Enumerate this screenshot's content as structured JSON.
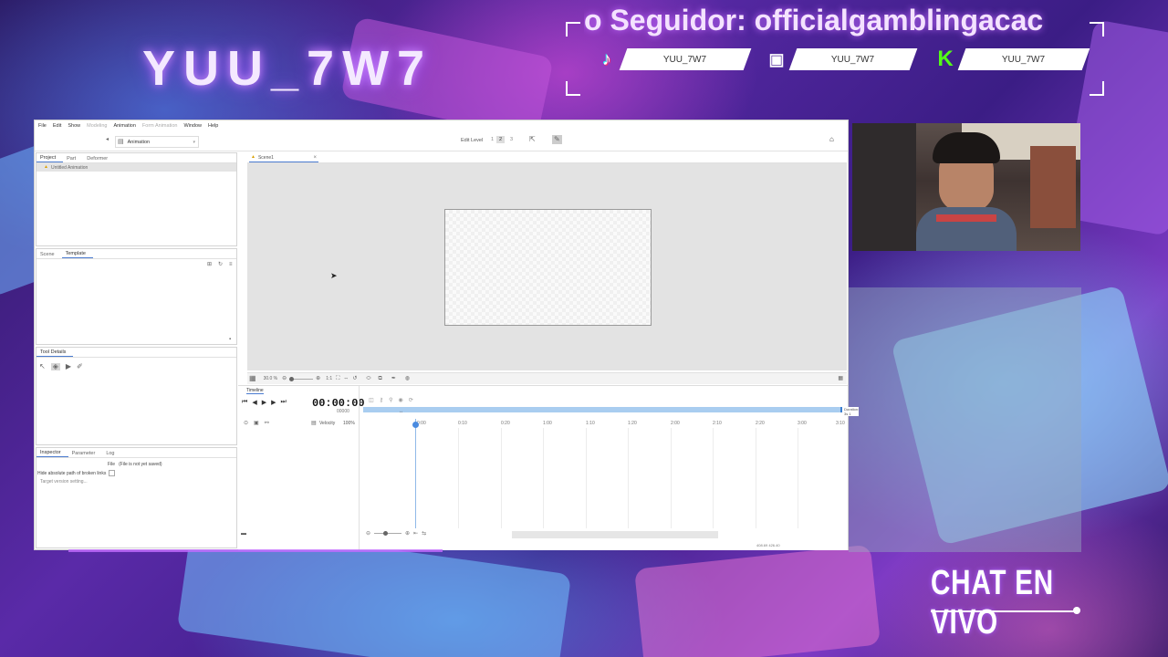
{
  "overlay": {
    "streamer_name": "YUU_7W7",
    "follower_text": "o Seguidor: officialgamblingacac",
    "socials": [
      {
        "icon": "tiktok-icon",
        "handle": "YUU_7W7"
      },
      {
        "icon": "twitch-icon",
        "handle": "YUU_7W7"
      },
      {
        "icon": "kick-icon",
        "handle": "YUU_7W7"
      }
    ],
    "chat_title": "CHAT EN VIVO",
    "colors": {
      "accent": "#b36bff",
      "kick_green": "#53fc18"
    }
  },
  "app": {
    "menu": [
      "File",
      "Edit",
      "Show",
      "Modeling",
      "Animation",
      "Form Animation",
      "Window",
      "Help"
    ],
    "menu_dim": [
      false,
      false,
      false,
      true,
      false,
      true,
      false,
      false
    ],
    "workspace": "Animation",
    "edit_level_label": "Edit Level",
    "edit_levels": [
      "1",
      "2",
      "3"
    ],
    "project_tabs": [
      "Project",
      "Part",
      "Deformer"
    ],
    "project_item": "Untitled Animation",
    "scene_tabs": [
      "Scene",
      "Template"
    ],
    "tool_details_label": "Tool Details",
    "inspector_tabs": [
      "Inspector",
      "Parameter",
      "Log"
    ],
    "file_label": "File",
    "file_value": "(File is not yet saved)",
    "hide_path_label": "Hide absolute path of broken links",
    "target_version_label": "Target version setting...",
    "scene_tab": "Scene1",
    "zoom_value": "30.0 %",
    "one_to_one": "1:1",
    "timeline_label": "Timeline",
    "time_display": "00:00:00",
    "frame_display": "00000",
    "velocity_label": "Velocity",
    "velocity_value": "100%",
    "ticks": [
      "0:00",
      "0:10",
      "0:20",
      "1:00",
      "1:10",
      "1:20",
      "2:00",
      "2:10",
      "2:20",
      "3:00",
      "3:10"
    ],
    "duration_label": "Duration: 3s 1",
    "status_text": "408.69  426.40"
  }
}
